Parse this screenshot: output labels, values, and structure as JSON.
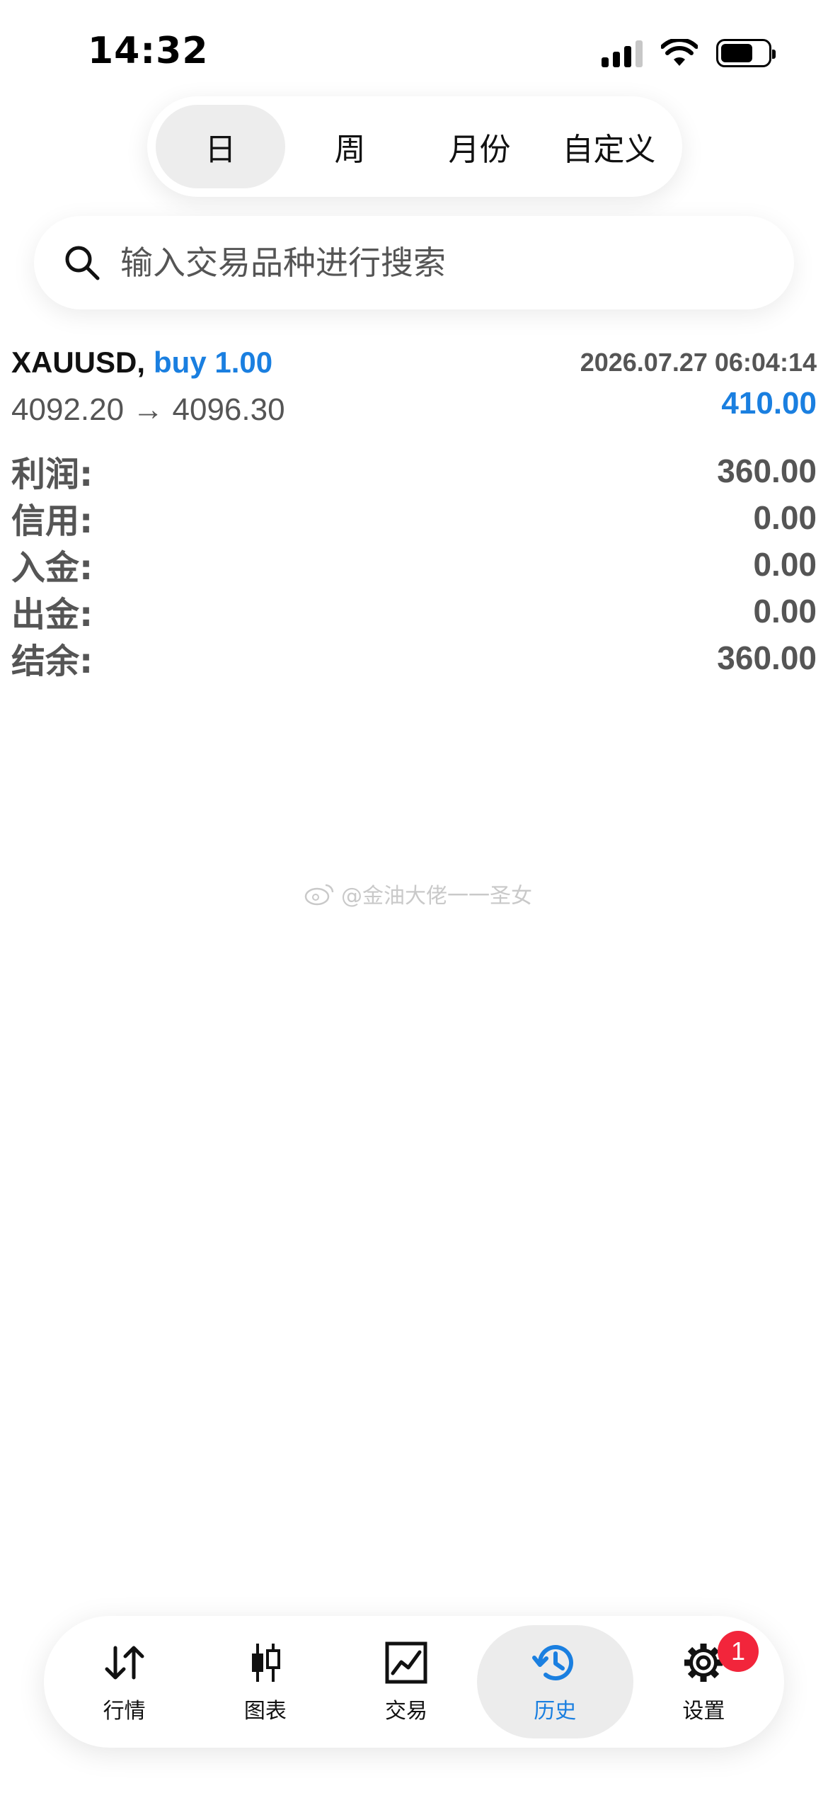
{
  "status_bar": {
    "time": "14:32"
  },
  "period_tabs": [
    {
      "label": "日",
      "active": true
    },
    {
      "label": "周",
      "active": false
    },
    {
      "label": "月份",
      "active": false
    },
    {
      "label": "自定义",
      "active": false
    }
  ],
  "search": {
    "placeholder": "输入交易品种进行搜索",
    "value": ""
  },
  "trade": {
    "symbol": "XAUUSD,",
    "side": "buy 1.00",
    "datetime": "2026.07.27 06:04:14",
    "prices": "4092.20 → 4096.30",
    "profit": "410.00"
  },
  "summary": {
    "profit_label": "利润:",
    "profit_value": "360.00",
    "credit_label": "信用:",
    "credit_value": "0.00",
    "deposit_label": "入金:",
    "deposit_value": "0.00",
    "withdrawal_label": "出金:",
    "withdrawal_value": "0.00",
    "balance_label": "结余:",
    "balance_value": "360.00"
  },
  "watermark": {
    "text": "@金油大佬一一圣女"
  },
  "bottom_nav": {
    "quotes": {
      "label": "行情",
      "icon": "arrows-updown-icon"
    },
    "chart": {
      "label": "图表",
      "icon": "candlestick-icon"
    },
    "trade": {
      "label": "交易",
      "icon": "trade-chart-icon"
    },
    "history": {
      "label": "历史",
      "icon": "history-icon",
      "active": true
    },
    "settings": {
      "label": "设置",
      "icon": "gear-icon",
      "badge": "1"
    }
  },
  "colors": {
    "accent": "#1a7fe0",
    "badge": "#f2253b",
    "muted": "#555555"
  }
}
